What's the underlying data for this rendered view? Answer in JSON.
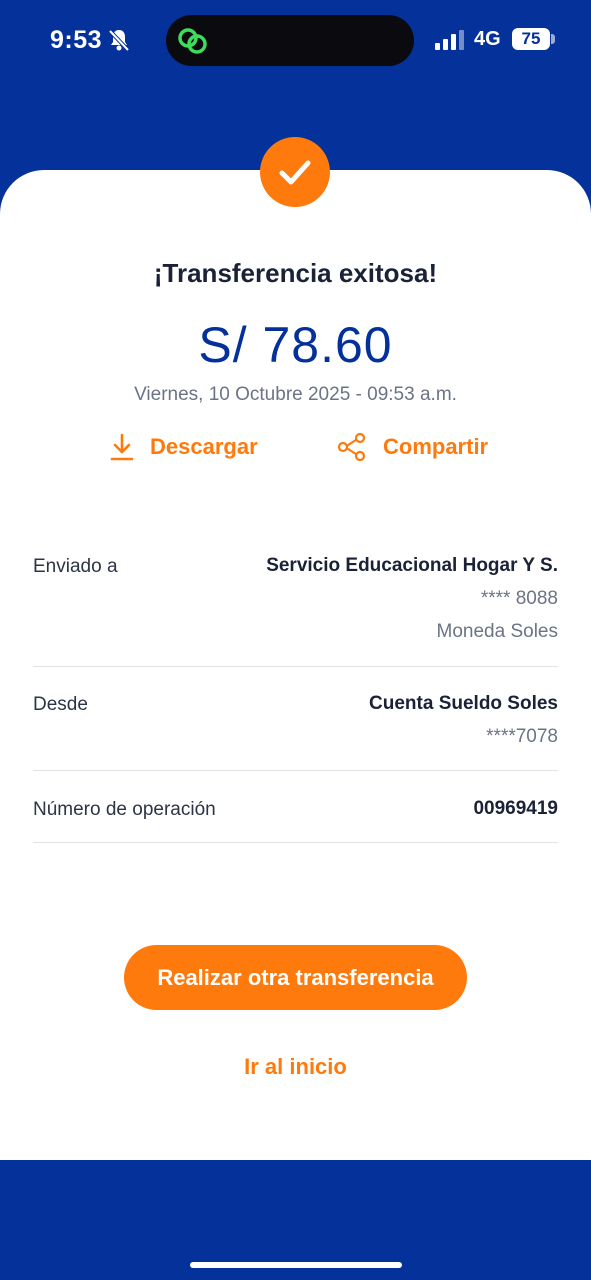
{
  "status_bar": {
    "time": "9:53",
    "network": "4G",
    "battery": "75"
  },
  "receipt": {
    "title": "¡Transferencia exitosa!",
    "amount": "S/ 78.60",
    "datetime": "Viernes, 10 Octubre 2025 - 09:53 a.m."
  },
  "actions": {
    "download_label": "Descargar",
    "share_label": "Compartir"
  },
  "details": {
    "sent_to": {
      "label": "Enviado a",
      "name": "Servicio Educacional Hogar Y S.",
      "account": "**** 8088",
      "currency": "Moneda Soles"
    },
    "from": {
      "label": "Desde",
      "name": "Cuenta Sueldo Soles",
      "account": "****7078"
    },
    "operation": {
      "label": "Número de operación",
      "number": "00969419"
    }
  },
  "buttons": {
    "new_transfer": "Realizar otra transferencia",
    "go_home": "Ir al inicio"
  },
  "colors": {
    "brand_blue": "#04319a",
    "accent_orange": "#ff7a0d",
    "success_green_link": "#3ddc5a"
  }
}
